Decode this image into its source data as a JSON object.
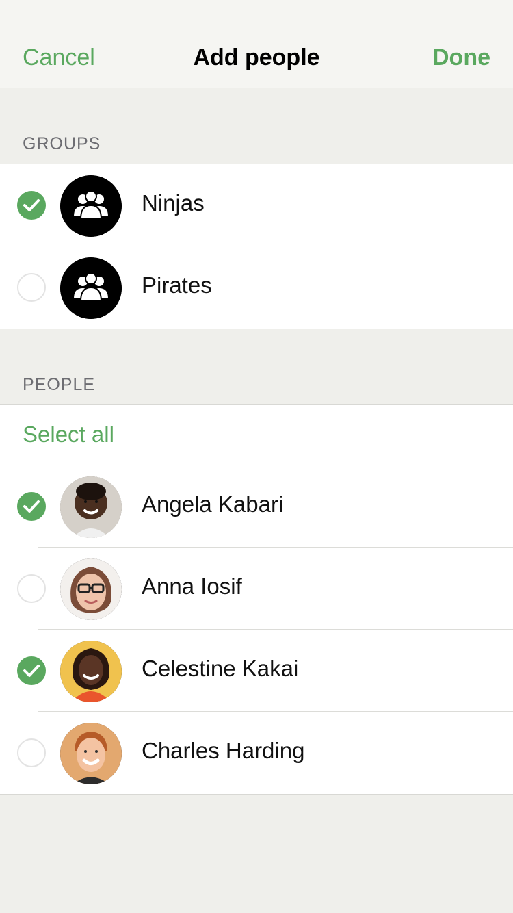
{
  "navbar": {
    "cancel_label": "Cancel",
    "title": "Add people",
    "done_label": "Done"
  },
  "groups": {
    "header": "GROUPS",
    "items": [
      {
        "label": "Ninjas",
        "selected": true,
        "icon": "group-icon"
      },
      {
        "label": "Pirates",
        "selected": false,
        "icon": "group-icon"
      }
    ]
  },
  "people": {
    "header": "PEOPLE",
    "select_all_label": "Select all",
    "items": [
      {
        "label": "Angela Kabari",
        "selected": true,
        "avatar": "avatar-photo"
      },
      {
        "label": "Anna Iosif",
        "selected": false,
        "avatar": "avatar-photo"
      },
      {
        "label": "Celestine Kakai",
        "selected": true,
        "avatar": "avatar-photo"
      },
      {
        "label": "Charles Harding",
        "selected": false,
        "avatar": "avatar-photo"
      }
    ]
  },
  "colors": {
    "accent": "#5aa85f",
    "background": "#efefeb",
    "navbar": "#f5f5f2"
  }
}
